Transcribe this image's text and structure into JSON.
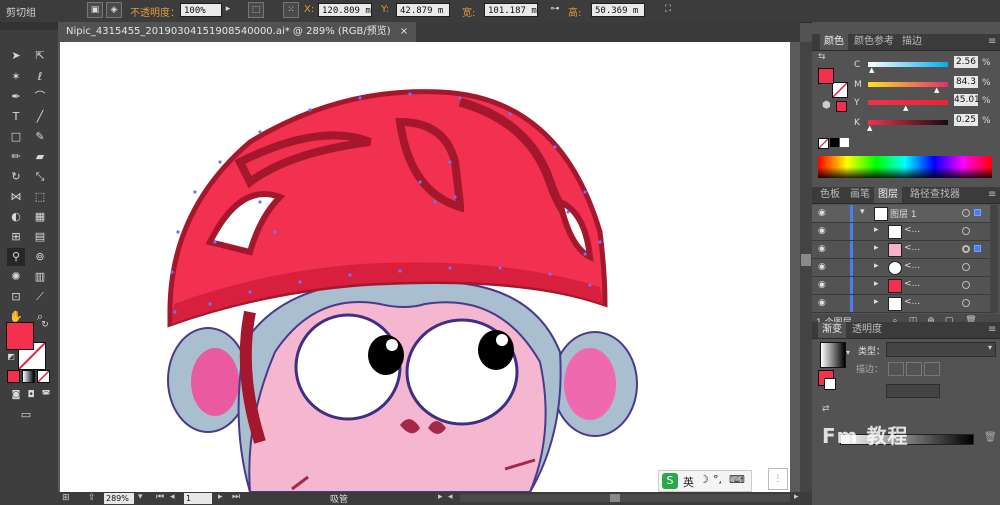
{
  "control_bar": {
    "object_type": "剪切组",
    "opacity_label": "不透明度：",
    "opacity_value": "100%",
    "x_label": "X:",
    "x_value": "120.809 m",
    "y_label": "Y:",
    "y_value": "42.879 m",
    "w_label": "宽:",
    "w_value": "101.187 m",
    "h_label": "高:",
    "h_value": "50.369 m"
  },
  "document": {
    "tab_title": "Nipic_4315455_20190304151908540000.ai* @ 289% (RGB/预览)",
    "close_glyph": "×"
  },
  "status_bar": {
    "zoom": "289%",
    "page": "1",
    "tool_name": "吸管"
  },
  "color_panel": {
    "tabs": [
      "颜色",
      "颜色参考",
      "描边"
    ],
    "channels": [
      {
        "label": "C",
        "value": "2.56",
        "unit": "%"
      },
      {
        "label": "M",
        "value": "84.3",
        "unit": "%"
      },
      {
        "label": "Y",
        "value": "45.01",
        "unit": "%"
      },
      {
        "label": "K",
        "value": "0.25",
        "unit": "%"
      }
    ],
    "channel_fractions": [
      0.03,
      0.84,
      0.45,
      0.0
    ]
  },
  "layers_panel": {
    "tabs": [
      "色板",
      "画笔",
      "图层",
      "路径查找器"
    ],
    "top_layer": "图层 1",
    "sublayers": [
      "<...",
      "<...",
      "<...",
      "<...",
      "<..."
    ],
    "footer_count": "1 个图层"
  },
  "gradient_panel": {
    "tabs": [
      "渐变",
      "透明度"
    ],
    "type_label": "类型：",
    "stroke_label": "描边："
  },
  "ime": {
    "indicator": "英"
  },
  "watermark": "Fm 教程",
  "colors": {
    "fill": "#f5304f",
    "helmet": "#f2304f",
    "helmet_dark": "#a4172c",
    "face": "#f5b6d0",
    "ear": "#a9bfd0",
    "path_points": "#6b73ff"
  }
}
